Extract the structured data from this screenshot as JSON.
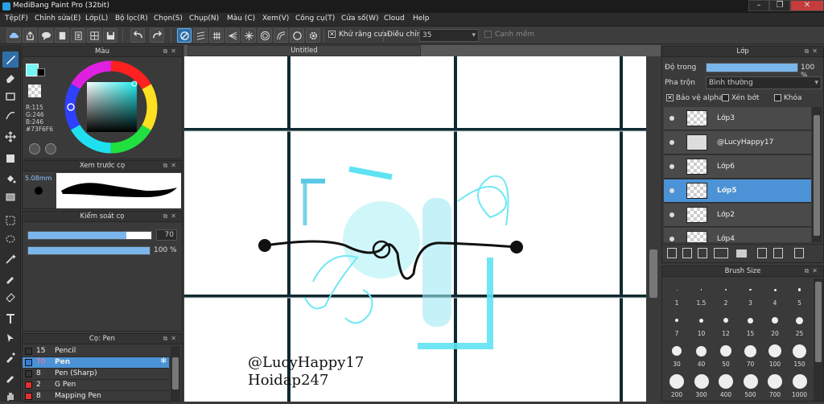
{
  "window": {
    "title": "MediBang Paint Pro (32bit)"
  },
  "menu": [
    "Tệp(F)",
    "Chỉnh sửa(E)",
    "Lớp(L)",
    "Bộ lọc(R)",
    "Chọn(S)",
    "Chụp(N)",
    "Màu (C)",
    "Xem(V)",
    "Công cụ(T)",
    "Cửa số(W)",
    "Cloud",
    "Help"
  ],
  "toolbar": {
    "antialias_label": "Khử răng cưa",
    "adjust_label": "Điều chỉnh",
    "adjust_value": "35",
    "smooth_label": "Cạnh mềm"
  },
  "color_panel": {
    "title": "Màu",
    "r": "R:115",
    "g": "G:246",
    "b": "B:246",
    "hex": "#73F6F6",
    "primary": "#73f6f6"
  },
  "brush_preview": {
    "title": "Xem trước cọ",
    "size": "5.08mm"
  },
  "brush_control": {
    "title": "Kiểm soát cọ",
    "size_value": "70",
    "opacity_value": "100 %",
    "size_fraction": 0.8,
    "opacity_fraction": 1.0
  },
  "brush_list": {
    "title": "Cọ: Pen",
    "items": [
      {
        "size": "15",
        "name": "Pencil",
        "color": "#333333"
      },
      {
        "size": "70",
        "name": "Pen",
        "color": "#3a7bd5",
        "selected": true
      },
      {
        "size": "8",
        "name": "Pen (Sharp)",
        "color": "#333333"
      },
      {
        "size": "2",
        "name": "G Pen",
        "color": "#e03030"
      },
      {
        "size": "8",
        "name": "Mapping Pen",
        "color": "#e03030"
      }
    ]
  },
  "document": {
    "tab": "Untitled",
    "watermark_line1": "@LucyHappy17",
    "watermark_line2": "Hoidap247"
  },
  "layer_panel": {
    "title": "Lớp",
    "opacity_label": "Độ trong",
    "opacity_value": "100 %",
    "blend_label": "Pha trộn",
    "blend_value": "Bình thường",
    "protect_alpha": "Bảo vệ alpha",
    "clipping": "Xén bớt",
    "lock": "Khóa",
    "layers": [
      {
        "name": "Lớp3"
      },
      {
        "name": "@LucyHappy17"
      },
      {
        "name": "Lớp6"
      },
      {
        "name": "Lớp5",
        "selected": true
      },
      {
        "name": "Lớp2"
      },
      {
        "name": "Lớp4"
      }
    ]
  },
  "brush_size": {
    "title": "Brush Size",
    "sizes": [
      "1",
      "1.5",
      "2",
      "3",
      "4",
      "5",
      "7",
      "10",
      "12",
      "15",
      "20",
      "25",
      "30",
      "40",
      "50",
      "70",
      "100",
      "150",
      "200",
      "300",
      "400",
      "500",
      "700",
      "1000"
    ]
  },
  "colors": {
    "accent": "#4b92d6",
    "cyan": "#5ee3f2"
  }
}
